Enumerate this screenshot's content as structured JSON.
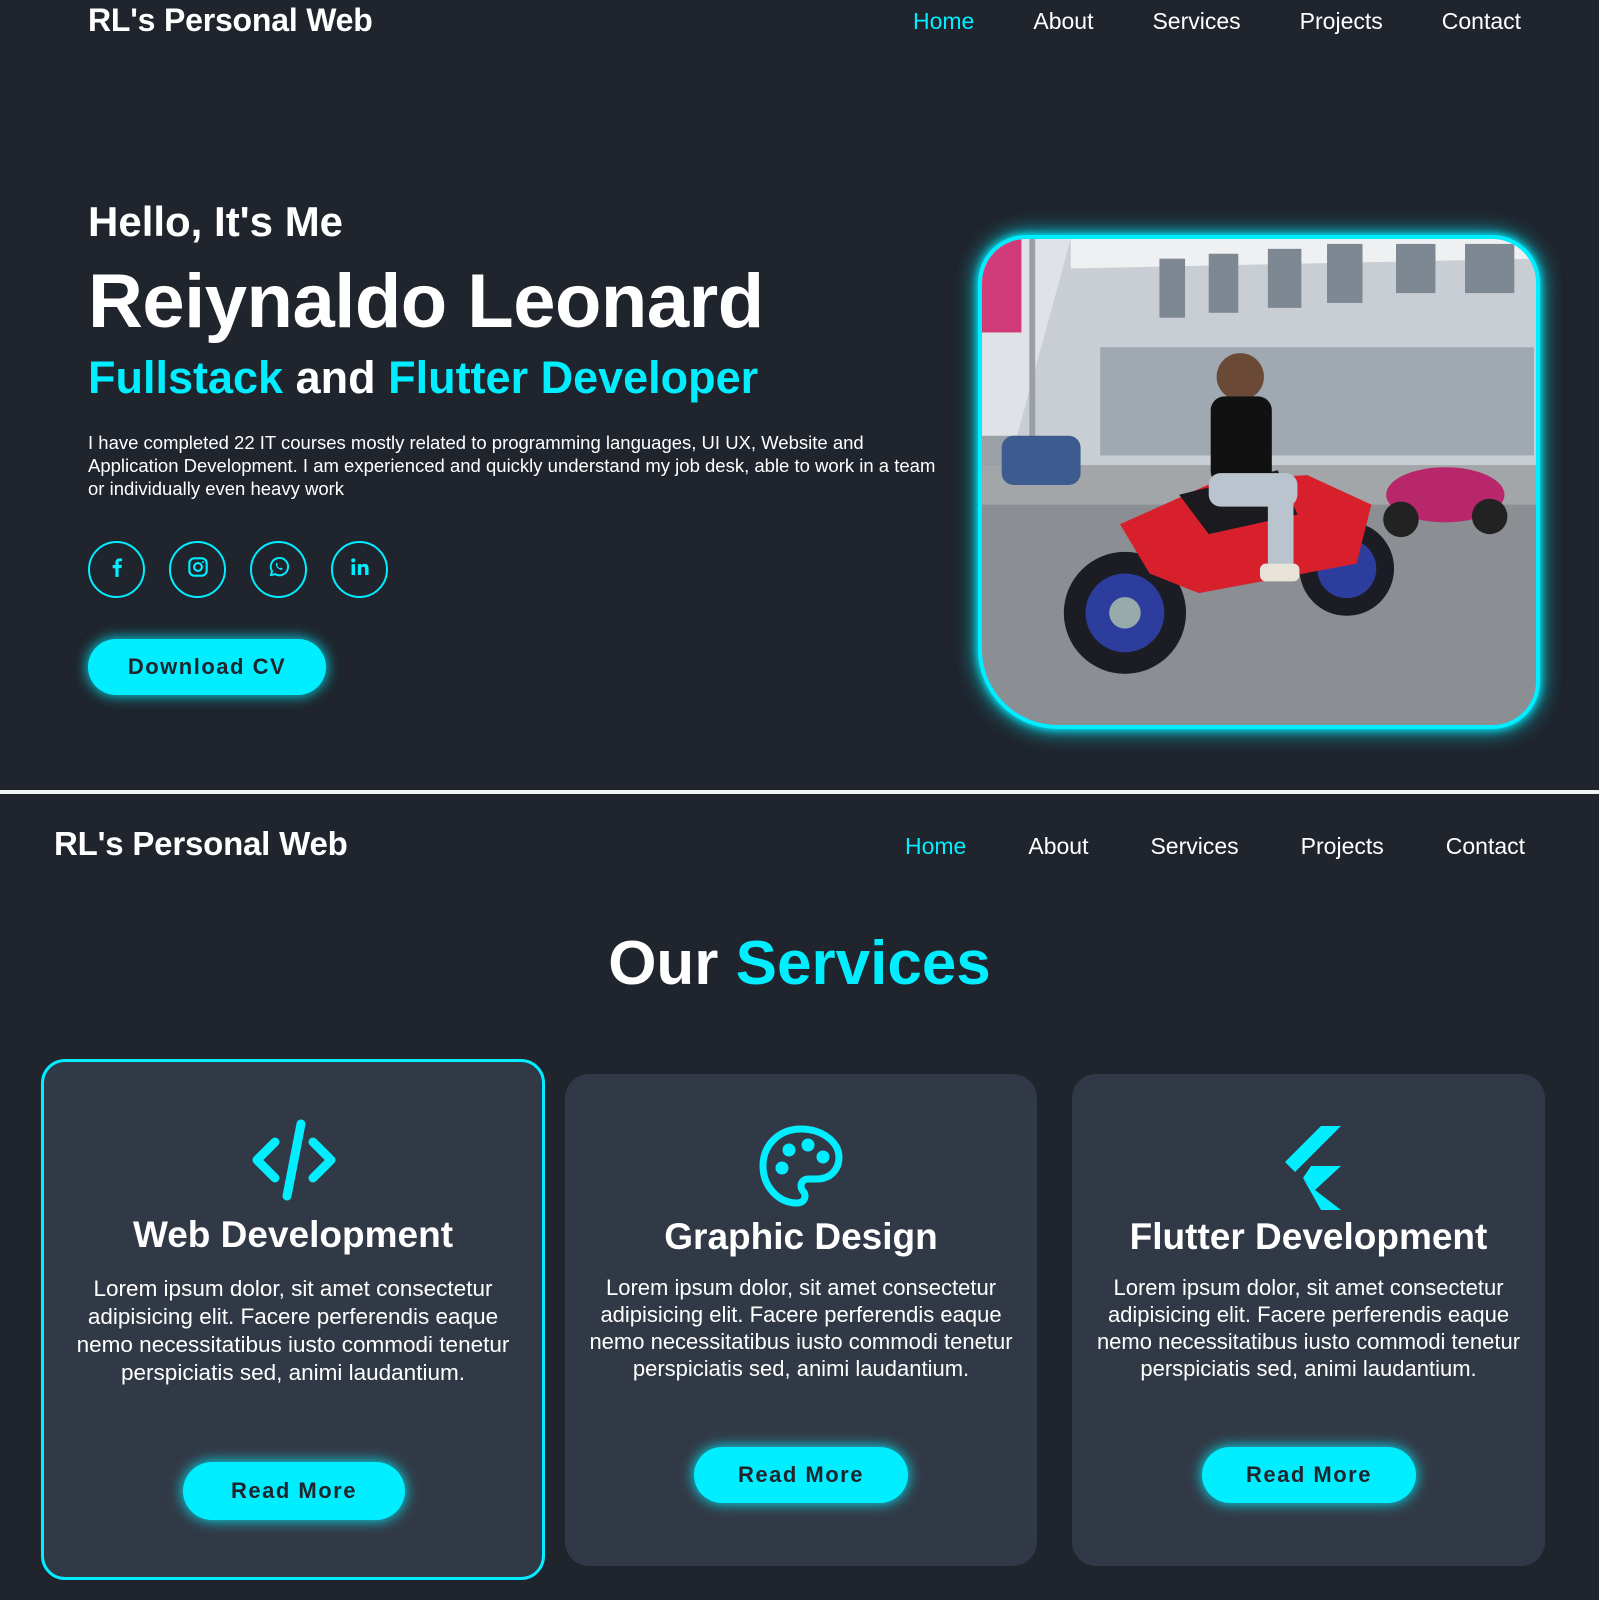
{
  "site": {
    "logo": "RL's Personal Web",
    "nav": [
      "Home",
      "About",
      "Services",
      "Projects",
      "Contact"
    ],
    "active_nav": "Home"
  },
  "home": {
    "greeting": "Hello, It's Me",
    "name": "Reiynaldo Leonard",
    "role_part1": "Fullstack",
    "role_connector": " and ",
    "role_part2": "Flutter Developer",
    "bio": "I have completed 22 IT courses mostly related to programming languages, UI UX, Website and Application Development. I am experienced and quickly understand my job desk, able to work in a team or individually even heavy work",
    "socials": [
      "facebook-icon",
      "instagram-icon",
      "whatsapp-icon",
      "linkedin-icon"
    ],
    "cv_button": "Download CV"
  },
  "services": {
    "title_white": "Our",
    "title_cyan": "Services",
    "cards": [
      {
        "icon": "code-icon",
        "title": "Web Development",
        "text": "Lorem ipsum dolor, sit amet consectetur adipisicing elit. Facere perferendis eaque nemo necessitatibus iusto commodi tenetur perspiciatis sed, animi laudantium.",
        "button": "Read More"
      },
      {
        "icon": "palette-icon",
        "title": "Graphic Design",
        "text": "Lorem ipsum dolor, sit amet consectetur adipisicing elit. Facere perferendis eaque nemo necessitatibus iusto commodi tenetur perspiciatis sed, animi laudantium.",
        "button": "Read More"
      },
      {
        "icon": "flutter-icon",
        "title": "Flutter Development",
        "text": "Lorem ipsum dolor, sit amet consectetur adipisicing elit. Facere perferendis eaque nemo necessitatibus iusto commodi tenetur perspiciatis sed, animi laudantium.",
        "button": "Read More"
      }
    ]
  },
  "colors": {
    "background": "#1f242d",
    "card": "#323946",
    "accent": "#00eeff",
    "text": "#ffffff"
  }
}
